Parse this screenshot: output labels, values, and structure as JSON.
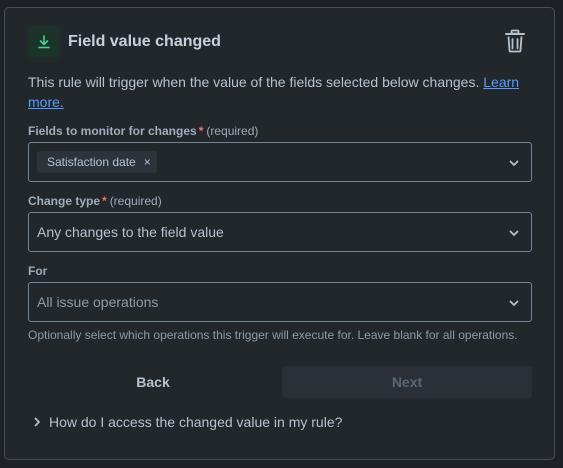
{
  "header": {
    "title": "Field value changed",
    "trigger_icon": "download-arrow-icon",
    "delete_icon": "trash-icon"
  },
  "description": {
    "text": "This rule will trigger when the value of the fields selected below changes. ",
    "link_text": "Learn more."
  },
  "fields_to_monitor": {
    "label": "Fields to monitor for changes",
    "required_marker": "*",
    "required_text": "(required)",
    "tags": [
      "Satisfaction date"
    ],
    "tag_remove": "×"
  },
  "change_type": {
    "label": "Change type",
    "required_marker": "*",
    "required_text": "(required)",
    "value": "Any changes to the field value"
  },
  "for_field": {
    "label": "For",
    "placeholder": "All issue operations",
    "helper": "Optionally select which operations this trigger will execute for. Leave blank for all operations."
  },
  "buttons": {
    "back": "Back",
    "next": "Next",
    "next_disabled": true
  },
  "faq": {
    "text": "How do I access the changed value in my rule?"
  },
  "colors": {
    "background": "#1d2125",
    "panel": "#22272b",
    "link": "#579dff",
    "required": "#f87168",
    "trigger_icon_bg": "#1c3329",
    "trigger_icon_fg": "#4bce97"
  }
}
